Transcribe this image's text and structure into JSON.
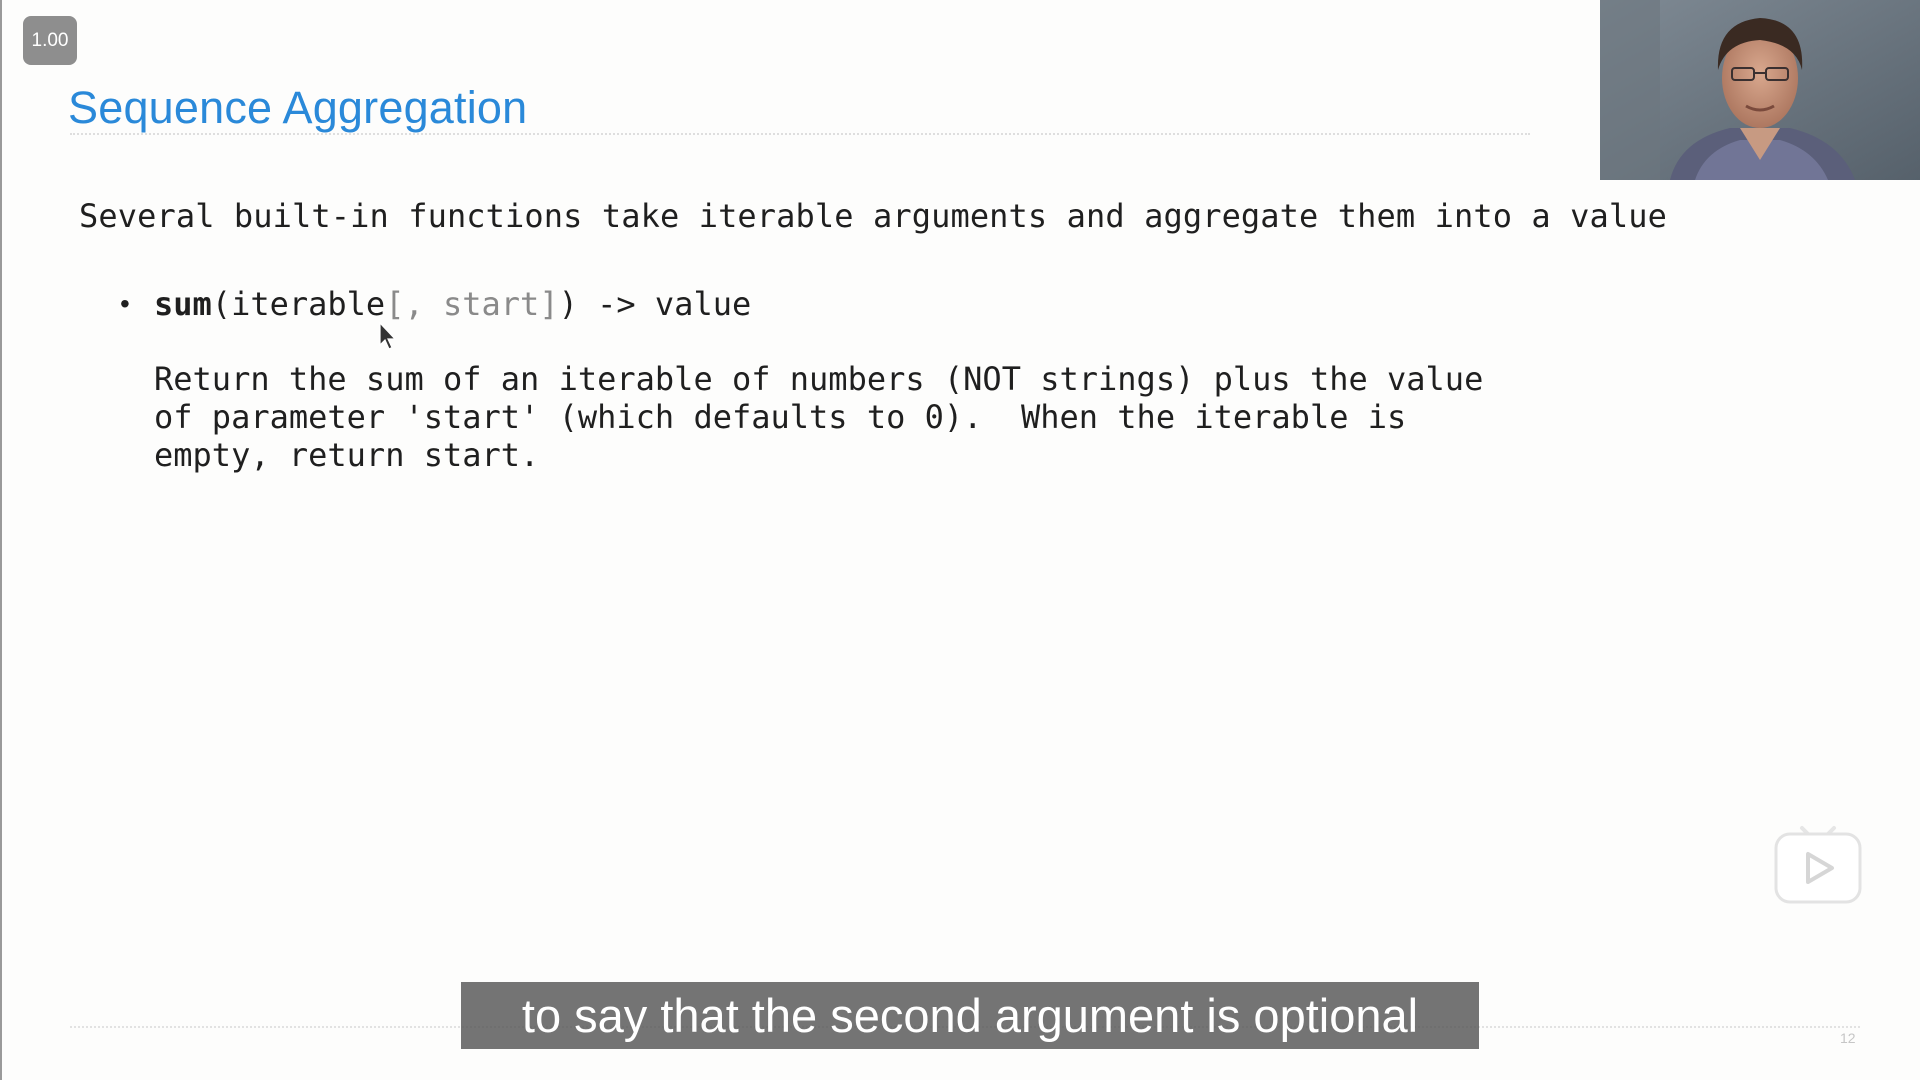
{
  "player": {
    "speed_label": "1.00",
    "subtitle": "to say that the second argument is optional"
  },
  "slide": {
    "title": "Sequence Aggregation",
    "intro": "Several built-in functions take iterable arguments and aggregate them into a value",
    "bullet": {
      "function_name": "sum",
      "open_paren": "(iterable",
      "optional_part": "[, start]",
      "close_and_return": ") -> value"
    },
    "description_lines": [
      "Return the sum of an iterable of numbers (NOT strings) plus the value",
      "of parameter 'start' (which defaults to 0).  When the iterable is",
      "empty, return start."
    ],
    "page_number": "12"
  },
  "colors": {
    "title": "#2a89d9",
    "body_text": "#1f1f1f",
    "optional_text": "#8a8a8a",
    "subtitle_bg": "#555555"
  },
  "icons": {
    "cursor": "mouse-pointer-icon",
    "logo": "video-player-logo-icon"
  }
}
